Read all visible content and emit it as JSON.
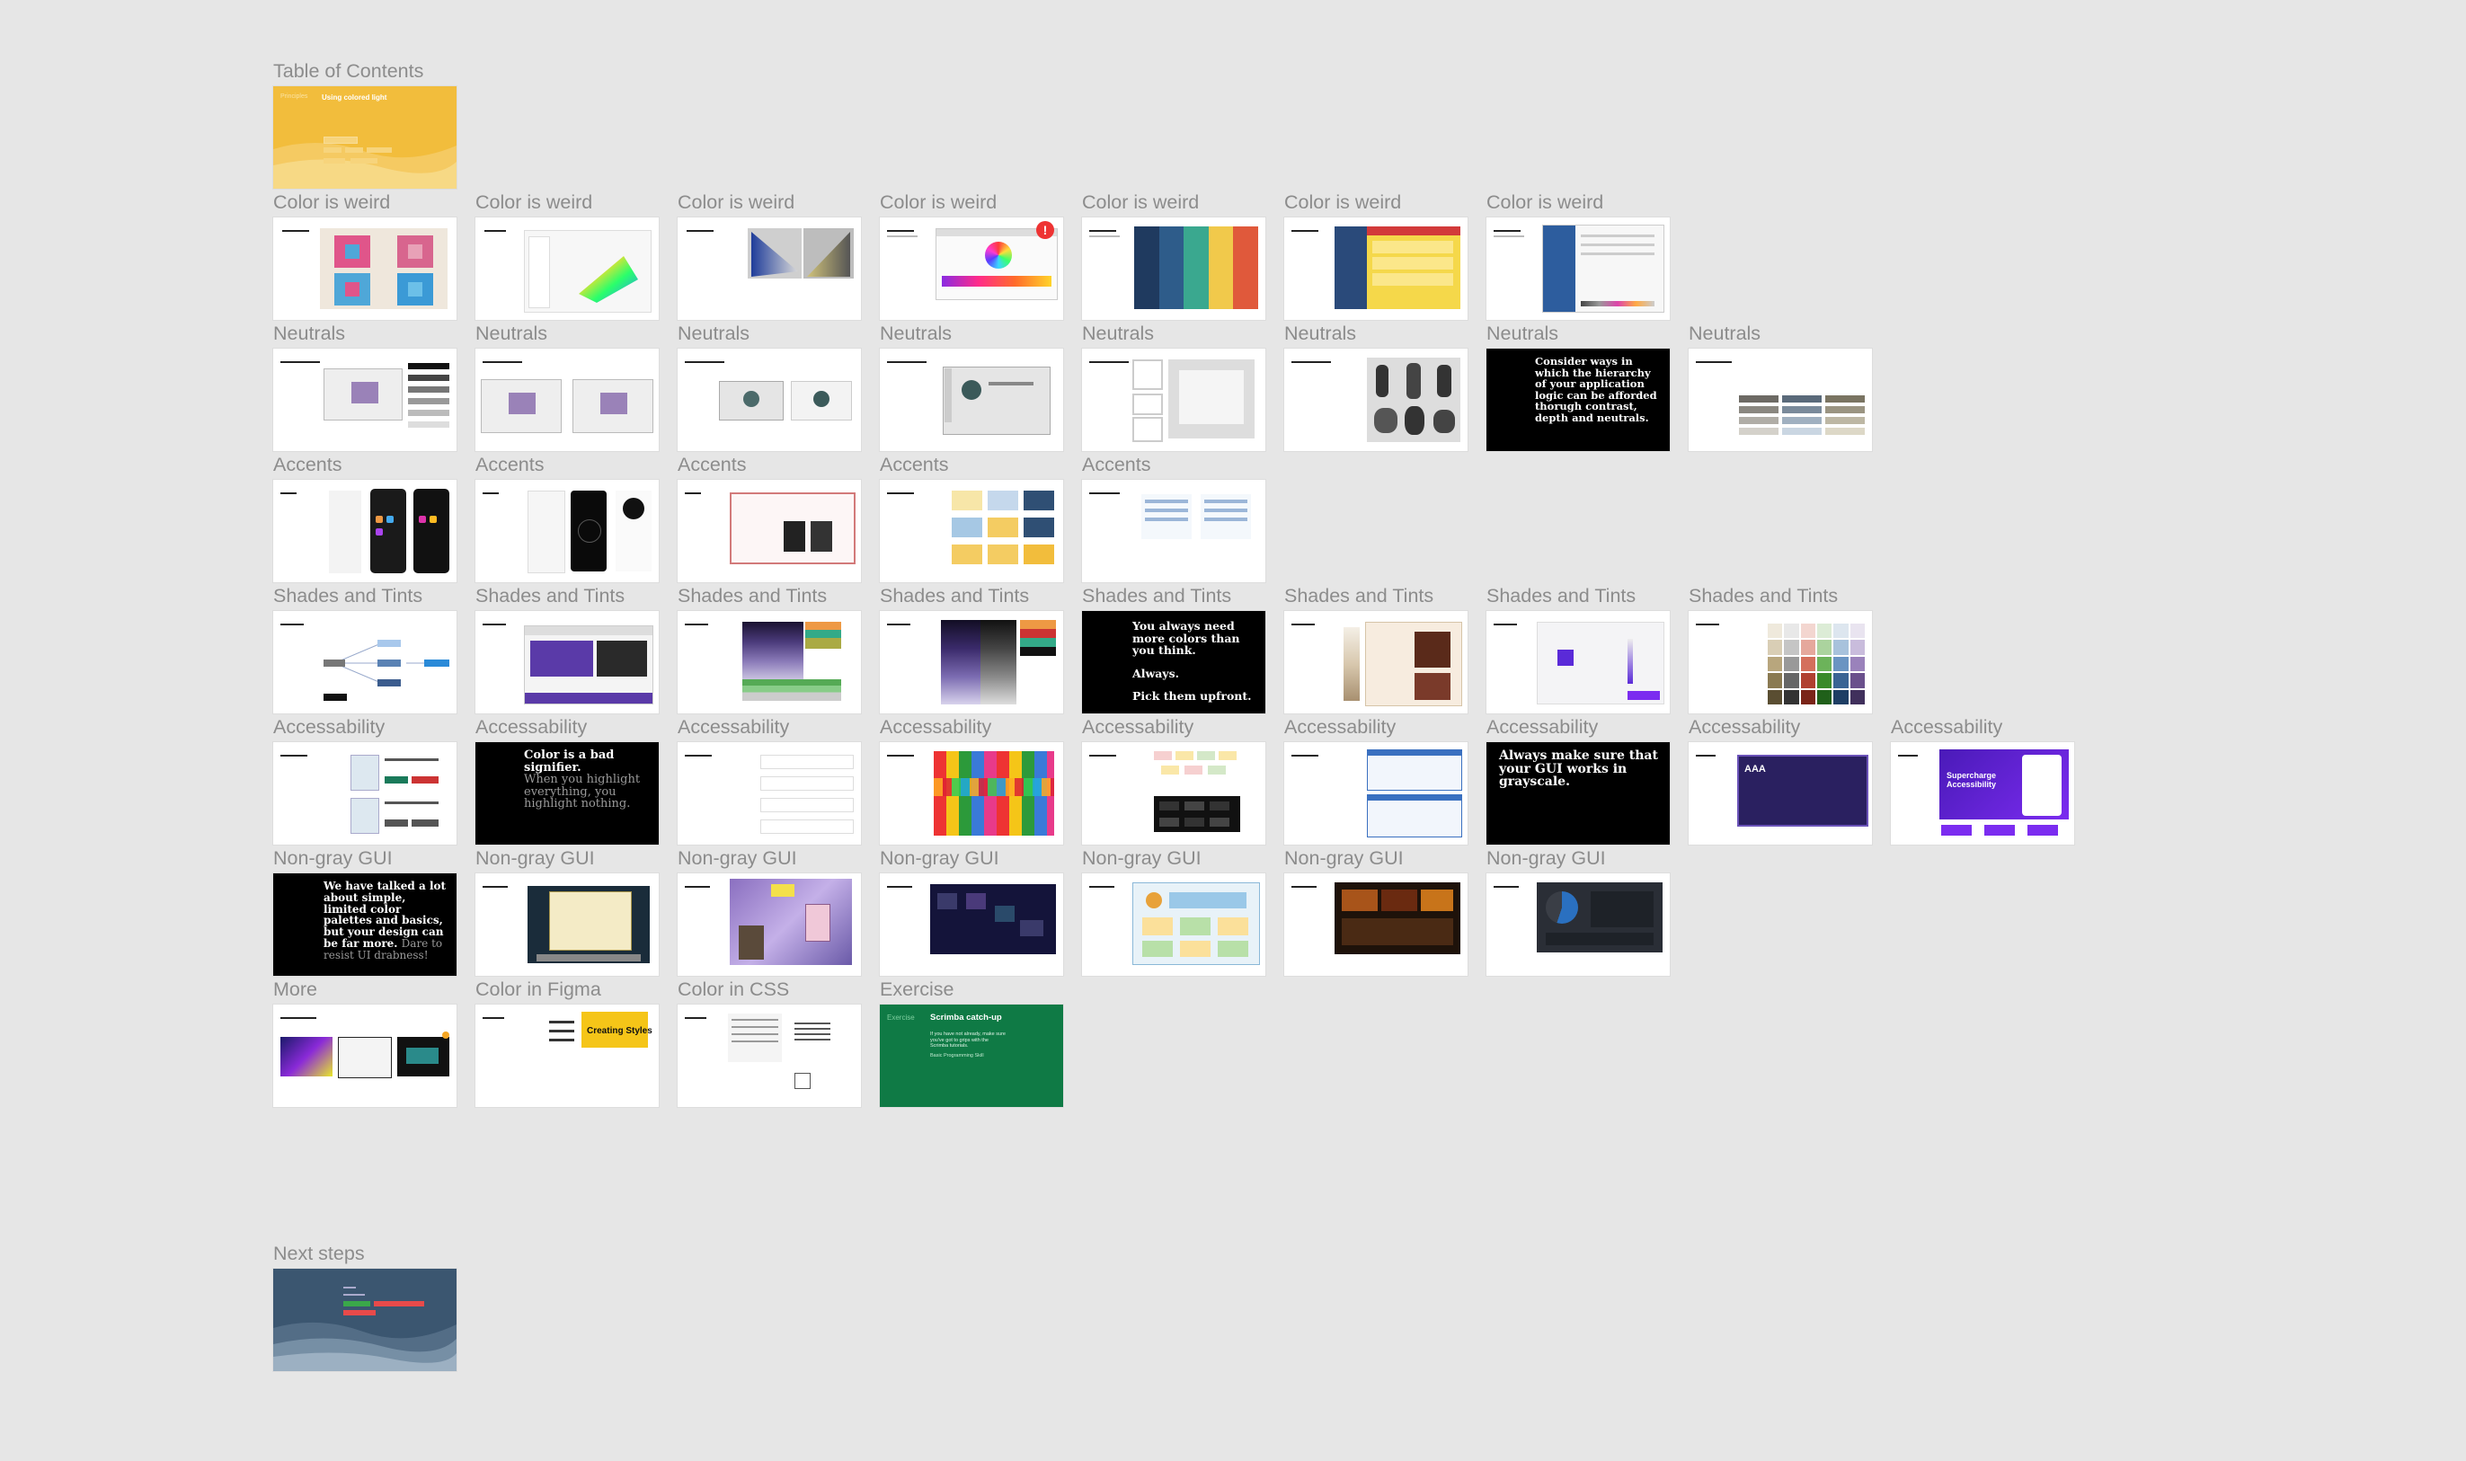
{
  "canvas": {
    "background": "#e6e6e6"
  },
  "sections": {
    "toc": "Table of Contents",
    "color_weird": "Color is weird",
    "neutrals": "Neutrals",
    "accents": "Accents",
    "shades": "Shades and Tints",
    "accessibility": "Accessability",
    "nongray": "Non-gray GUI",
    "more": "More",
    "figma": "Color in Figma",
    "css": "Color in CSS",
    "exercise": "Exercise",
    "next": "Next steps"
  },
  "toc_thumb": {
    "left": "Principles",
    "title": "Using colored light",
    "chips": [
      "",
      "",
      "",
      "",
      "",
      ""
    ]
  },
  "quotes": {
    "neutrals_hierarchy": "Consider ways in which the hierarchy of your application logic can be afforded thorugh contrast, depth and neutrals.",
    "more_colors_1": "You always need more colors than you think.",
    "more_colors_2": "Always.",
    "more_colors_3": "Pick them upfront.",
    "bad_signifier_1": "Color is a bad signifier.",
    "bad_signifier_2": "When you highlight everything, you highlight nothing.",
    "grayscale": "Always make sure that your GUI works in grayscale.",
    "simple_palettes_1": "We have talked a lot about simple, limited color palettes and basics, but your design can be far more.",
    "simple_palettes_2": "Dare to resist UI drabness!",
    "aaa": "AAA",
    "supercharge": "Supercharge Accessibility",
    "creating_styles": "Creating Styles"
  },
  "exercise_thumb": {
    "left": "Exercise",
    "title": "Scrimba catch-up",
    "body": "If you have not already, make sure you've got to grips with the Scrimba tutorials.",
    "link": "Basic Programming Skill"
  },
  "colors": {
    "toc_yellow": "#f2bd3c",
    "exercise_green": "#0f7a45",
    "next_steps_blue": "#3b5670",
    "accent_purple": "#7b2cf0"
  }
}
